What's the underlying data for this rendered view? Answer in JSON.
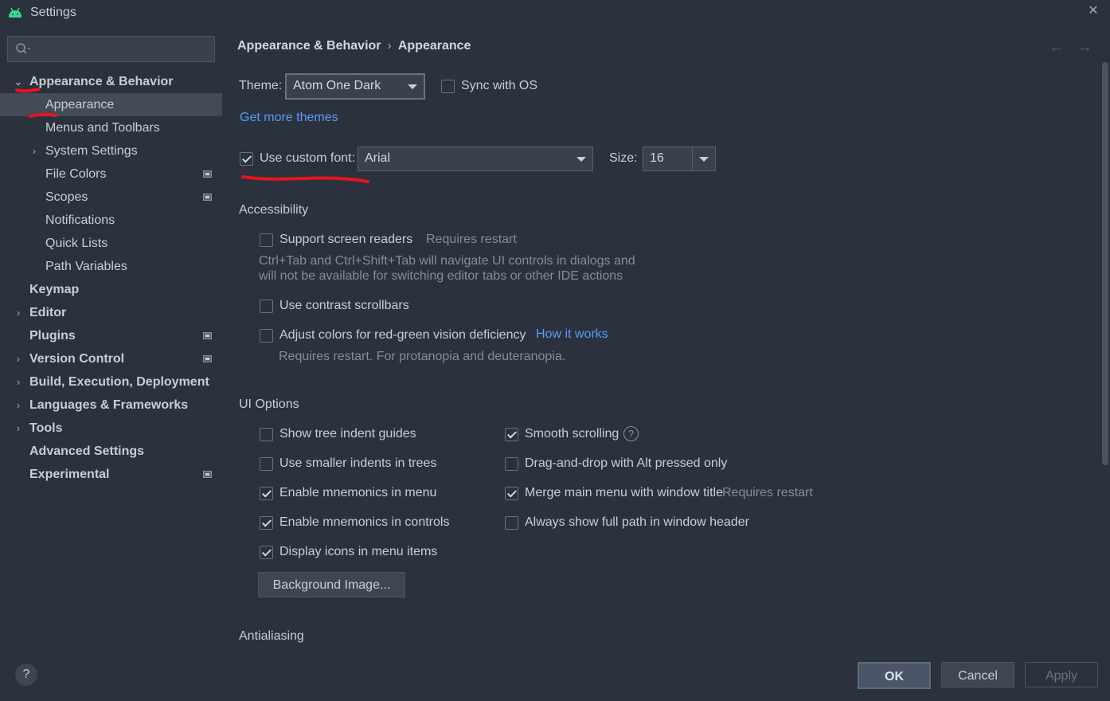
{
  "window": {
    "title": "Settings"
  },
  "sidebar": {
    "search_placeholder": "",
    "items": [
      {
        "label": "Appearance & Behavior",
        "chevron": "⌄"
      },
      {
        "label": "Appearance"
      },
      {
        "label": "Menus and Toolbars"
      },
      {
        "label": "System Settings",
        "chevron": "›"
      },
      {
        "label": "File Colors"
      },
      {
        "label": "Scopes"
      },
      {
        "label": "Notifications"
      },
      {
        "label": "Quick Lists"
      },
      {
        "label": "Path Variables"
      },
      {
        "label": "Keymap"
      },
      {
        "label": "Editor",
        "chevron": "›"
      },
      {
        "label": "Plugins"
      },
      {
        "label": "Version Control",
        "chevron": "›"
      },
      {
        "label": "Build, Execution, Deployment",
        "chevron": "›"
      },
      {
        "label": "Languages & Frameworks",
        "chevron": "›"
      },
      {
        "label": "Tools",
        "chevron": "›"
      },
      {
        "label": "Advanced Settings"
      },
      {
        "label": "Experimental"
      }
    ],
    "help": "?"
  },
  "breadcrumb": {
    "parent": "Appearance & Behavior",
    "separator": "›",
    "current": "Appearance"
  },
  "nav": {
    "back": "←",
    "forward": "→"
  },
  "theme": {
    "label": "Theme:",
    "value": "Atom One Dark",
    "sync_label": "Sync with OS",
    "sync_checked": false,
    "more_link": "Get more themes"
  },
  "font": {
    "custom_label": "Use custom font:",
    "custom_checked": true,
    "value": "Arial",
    "size_label": "Size:",
    "size_value": "16"
  },
  "accessibility": {
    "heading": "Accessibility",
    "screen_readers": {
      "label": "Support screen readers",
      "note": "Requires restart",
      "checked": false
    },
    "screen_readers_desc1": "Ctrl+Tab and Ctrl+Shift+Tab will navigate UI controls in dialogs and",
    "screen_readers_desc2": "will not be available for switching editor tabs or other IDE actions",
    "contrast_scrollbars": {
      "label": "Use contrast scrollbars",
      "checked": false
    },
    "color_deficiency": {
      "label": "Adjust colors for red-green vision deficiency",
      "link": "How it works",
      "checked": false
    },
    "color_deficiency_note": "Requires restart. For protanopia and deuteranopia."
  },
  "ui_options": {
    "heading": "UI Options",
    "left": [
      {
        "label": "Show tree indent guides",
        "checked": false
      },
      {
        "label": "Use smaller indents in trees",
        "checked": false
      },
      {
        "label": "Enable mnemonics in menu",
        "checked": true
      },
      {
        "label": "Enable mnemonics in controls",
        "checked": true
      },
      {
        "label": "Display icons in menu items",
        "checked": true
      }
    ],
    "right": [
      {
        "label": "Smooth scrolling",
        "checked": true
      },
      {
        "label": "Drag-and-drop with Alt pressed only",
        "checked": false
      },
      {
        "label": "Merge main menu with window title",
        "note": "Requires restart",
        "checked": true
      },
      {
        "label": "Always show full path in window header",
        "checked": false
      }
    ],
    "help_q": "?",
    "background_button": "Background Image..."
  },
  "antialiasing": {
    "heading": "Antialiasing"
  },
  "footer": {
    "ok": "OK",
    "cancel": "Cancel",
    "apply": "Apply"
  },
  "colors": {
    "background": "#2b313d",
    "selection": "#434a58",
    "link": "#589df6",
    "annotation": "#e8141c"
  }
}
